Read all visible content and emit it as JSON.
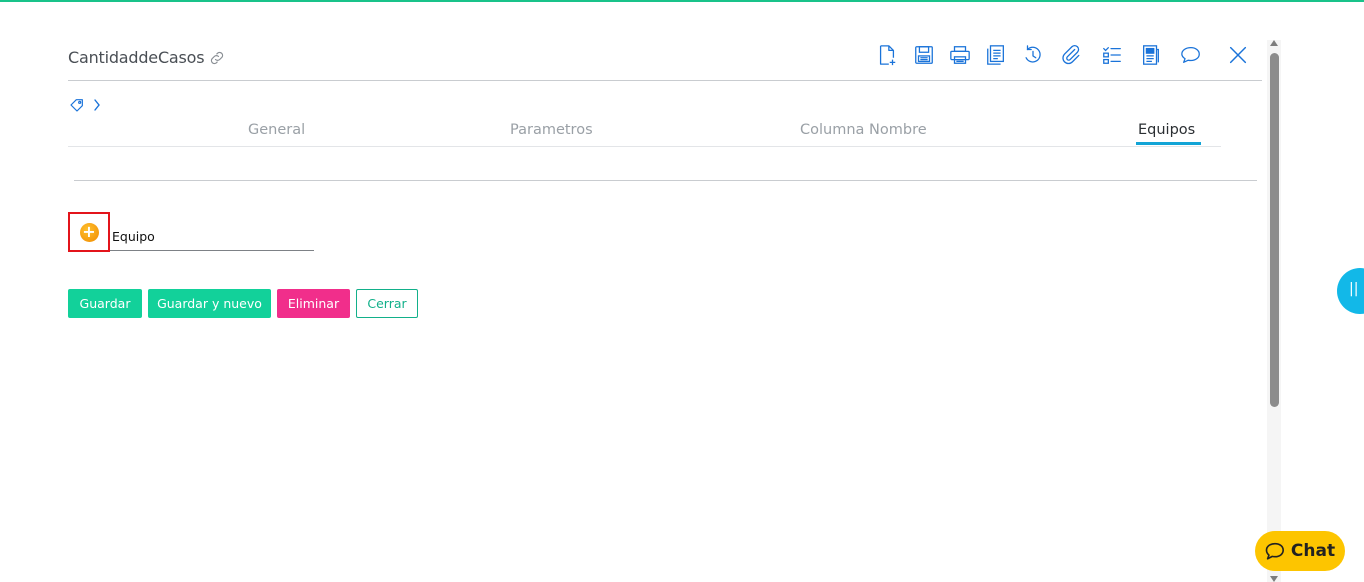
{
  "colors": {
    "accent_green": "#12d19a",
    "delete_pink": "#f12e8b",
    "tab_underline": "#12a4d6",
    "icon_blue": "#1a73d9",
    "chat_yellow": "#fdc500",
    "highlight_red": "#e3141b"
  },
  "header": {
    "title": "CantidaddeCasos",
    "title_icon": "link-icon"
  },
  "toolbar": [
    {
      "icon": "new-document-icon"
    },
    {
      "icon": "save-icon"
    },
    {
      "icon": "print-icon"
    },
    {
      "icon": "copy-icon"
    },
    {
      "icon": "history-icon"
    },
    {
      "icon": "attachment-icon"
    },
    {
      "icon": "checklist-icon"
    },
    {
      "icon": "form-icon"
    },
    {
      "icon": "comment-icon"
    },
    {
      "icon": "close-icon"
    }
  ],
  "breadcrumb": {
    "icon": "tag-icon",
    "separator_icon": "chevron-right-icon"
  },
  "tabs": [
    {
      "label": "General",
      "active": false
    },
    {
      "label": "Parametros",
      "active": false
    },
    {
      "label": "Columna Nombre",
      "active": false
    },
    {
      "label": "Equipos",
      "active": true
    }
  ],
  "equipo": {
    "add_icon": "plus-circle-icon",
    "add_symbol": "+",
    "label": "Equipo"
  },
  "buttons": {
    "guardar": "Guardar",
    "guardar_nuevo": "Guardar y nuevo",
    "eliminar": "Eliminar",
    "cerrar": "Cerrar"
  },
  "side_handle": {
    "symbol": "||"
  },
  "chat": {
    "label": "Chat",
    "icon": "chat-bubble-icon"
  }
}
